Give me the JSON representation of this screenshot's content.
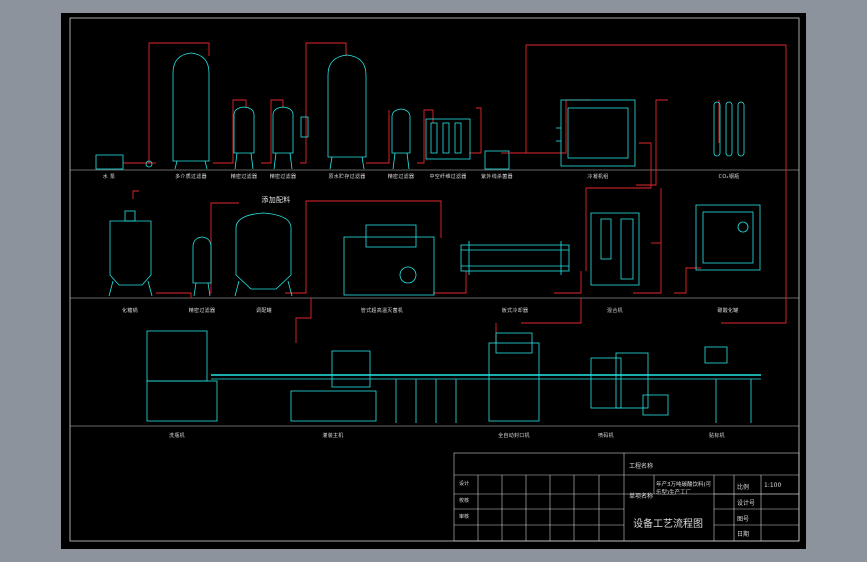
{
  "row1_labels": [
    "水 泵",
    "多介质过滤器",
    "精密过滤器",
    "精密过滤器",
    "原水贮存过滤器",
    "精密过滤器",
    "中空纤维过滤器",
    "紫外线杀菌器",
    "冷凝机组"
  ],
  "co2_label": "CO₂钢瓶",
  "row2_labels": [
    "化糖锅",
    "精密过滤器",
    "调配罐",
    "管式超高温灭菌机",
    "板式冷却器",
    "混合机",
    "碳酸化罐"
  ],
  "accessory_label": "添加配料",
  "row3_labels": [
    "洗瓶机",
    "灌装主机",
    "全自动封口机",
    "喷码机",
    "贴标机"
  ],
  "title_block": {
    "project_name_label": "工程名称",
    "item_name_label": "单项名称",
    "item_name_value": "年产3万吨碳酸饮料(可乐型)生产工厂",
    "drawing_title": "设备工艺流程图",
    "scale_label": "比例",
    "scale_value": "1:100",
    "design_no_label": "设计号",
    "sheet_no_label": "图号",
    "date_label": "日期",
    "signature_rows": [
      "设计",
      "校核",
      "审核"
    ]
  },
  "colors": {
    "equipment": "#27e5e5",
    "pipe": "#e5262a",
    "frame": "#d0d0d0"
  }
}
